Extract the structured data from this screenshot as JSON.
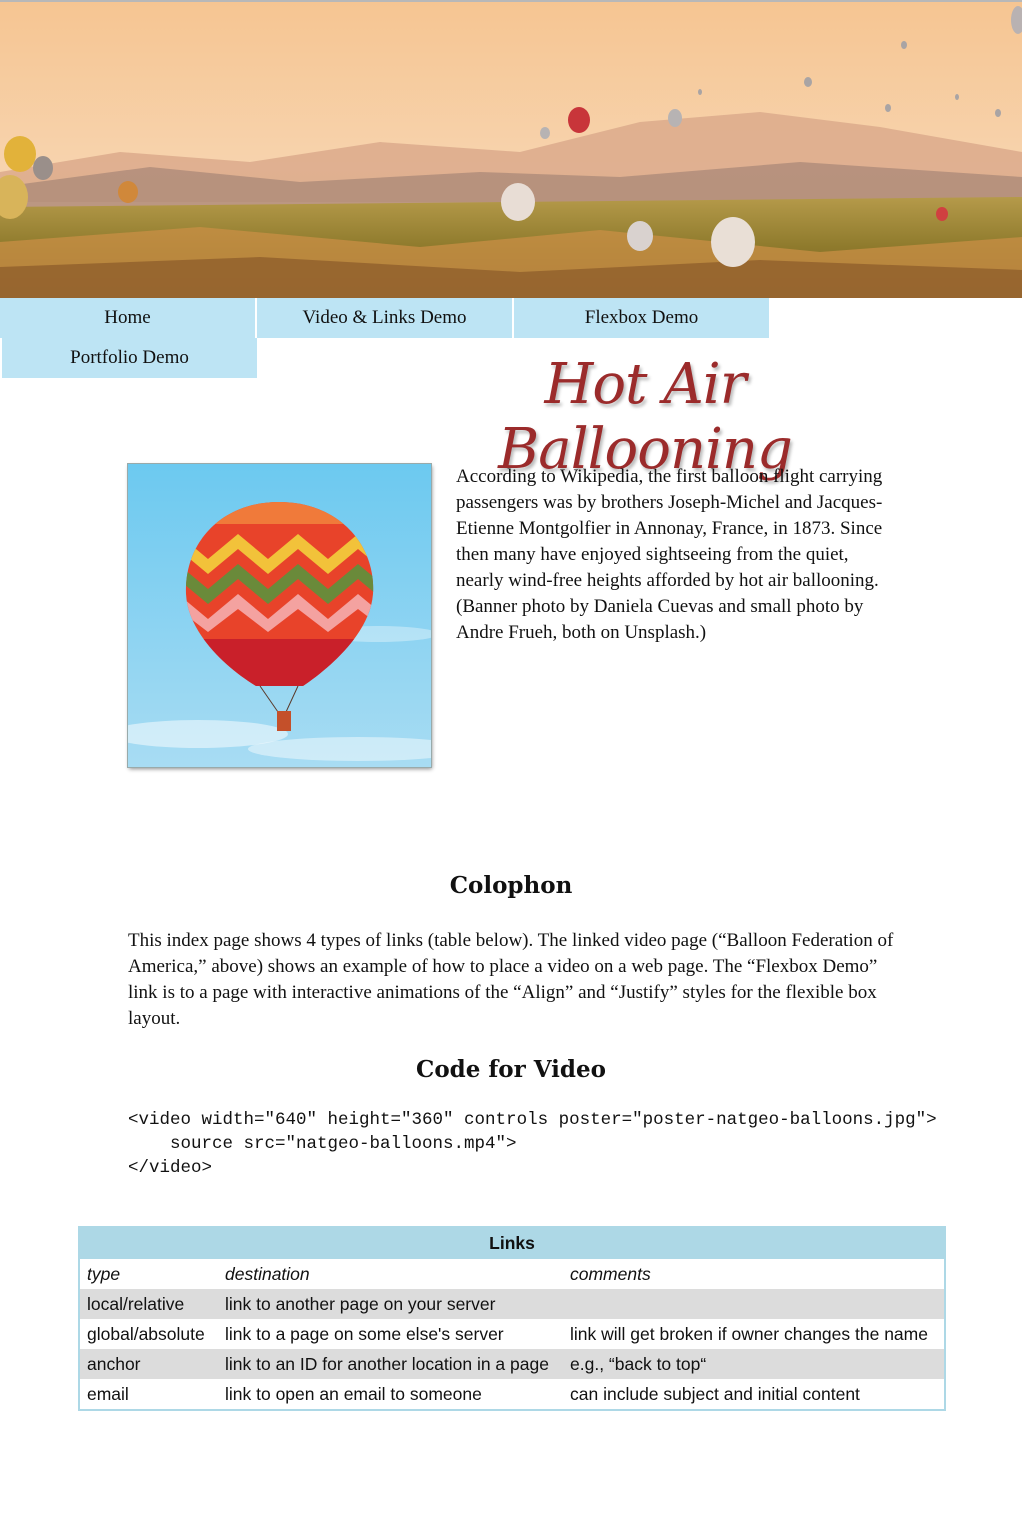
{
  "nav": {
    "items": [
      {
        "label": "Home"
      },
      {
        "label": "Video & Links Demo"
      },
      {
        "label": "Flexbox Demo"
      },
      {
        "label": "Portfolio Demo"
      }
    ]
  },
  "header": {
    "title": "Hot Air Ballooning"
  },
  "intro": {
    "text": "According to Wikipedia, the first balloon flight carrying passengers was by brothers Joseph-Michel and Jacques-Etienne Montgolfier in Annonay, France, in 1873. Since then many have enjoyed sightseeing from the quiet, nearly wind-free heights afforded by hot air ballooning. (Banner photo by Daniela Cuevas and small photo by Andre Frueh, both on Unsplash.)"
  },
  "colophon": {
    "heading": "Colophon",
    "text": "This index page shows 4 types of links (table below). The linked video page (“Balloon Federation of America,” above) shows an example of how to place a video on a web page. The “Flexbox Demo” link is to a page with interactive animations of the “Align” and “Justify” styles for the flexible box layout."
  },
  "code_section": {
    "heading": "Code for Video",
    "code": "<video width=\"640\" height=\"360\" controls poster=\"poster-natgeo-balloons.jpg\">\n    source src=\"natgeo-balloons.mp4\">\n</video>"
  },
  "links_table": {
    "caption": "Links",
    "columns": [
      "type",
      "destination",
      "comments"
    ],
    "rows": [
      [
        "local/relative",
        "link to another page on your server",
        ""
      ],
      [
        "global/absolute",
        "link to a page on some else's server",
        "link will get broken if owner changes the name"
      ],
      [
        "anchor",
        "link to an ID for another location in a page",
        "e.g., “back to top“"
      ],
      [
        "email",
        "link to open an email to someone",
        "can include subject and initial content"
      ]
    ]
  },
  "colors": {
    "nav_bg": "#bde4f4",
    "title": "#9b2b2b",
    "table_header": "#add8e6",
    "table_shade": "#dcdcdc"
  }
}
